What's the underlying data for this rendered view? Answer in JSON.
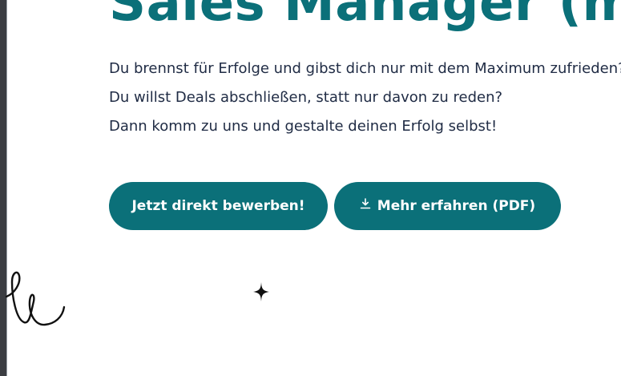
{
  "hero": {
    "headline": "Sales Manager (m",
    "intro_lines": [
      "Du brennst für Erfolge und gibst dich nur mit dem Maximum zufrieden?",
      "Du willst Deals abschließen, statt nur davon zu reden?",
      "Dann komm zu uns und gestalte deinen Erfolg selbst!"
    ]
  },
  "buttons": {
    "apply_label": "Jetzt direkt bewerben!",
    "pdf_label": "Mehr erfahren (PDF)",
    "pdf_icon": "download-icon"
  },
  "decor": {
    "sparkle_icon": "sparkle-icon",
    "scribble": "scribble-line"
  },
  "colors": {
    "brand": "#0b7079",
    "text": "#1f2b44",
    "button_text": "#ffffff"
  }
}
